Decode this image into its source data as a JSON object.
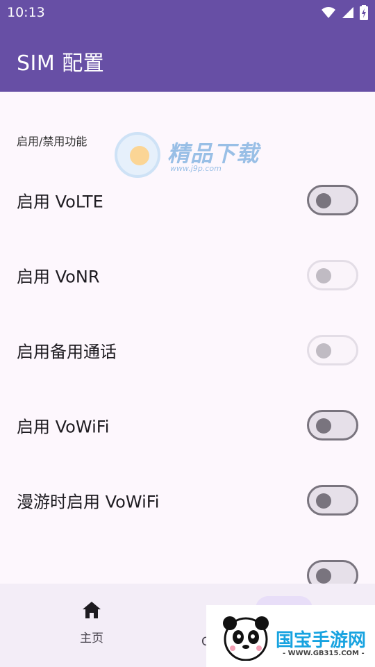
{
  "status_bar": {
    "time": "10:13"
  },
  "app_bar": {
    "title": "SIM 配置"
  },
  "section": {
    "header": "启用/禁用功能"
  },
  "settings": [
    {
      "label": "启用 VoLTE",
      "enabled": false,
      "disabled": false
    },
    {
      "label": "启用 VoNR",
      "enabled": false,
      "disabled": true
    },
    {
      "label": "启用备用通话",
      "enabled": false,
      "disabled": true
    },
    {
      "label": "启用 VoWiFi",
      "enabled": false,
      "disabled": false
    },
    {
      "label": "漫游时启用 VoWiFi",
      "enabled": false,
      "disabled": false
    }
  ],
  "bottom_nav": {
    "home_label": "主页",
    "second_label": "C"
  },
  "watermarks": {
    "top_title": "精品下载",
    "top_url": "www.j9p.com",
    "bottom_title": "国宝手游网",
    "bottom_url": "- WWW.GB315.COM -"
  },
  "colors": {
    "primary": "#674fa5",
    "background": "#fdf7fd",
    "switch_outline": "#79747e",
    "nav_background": "#f3edf7"
  }
}
